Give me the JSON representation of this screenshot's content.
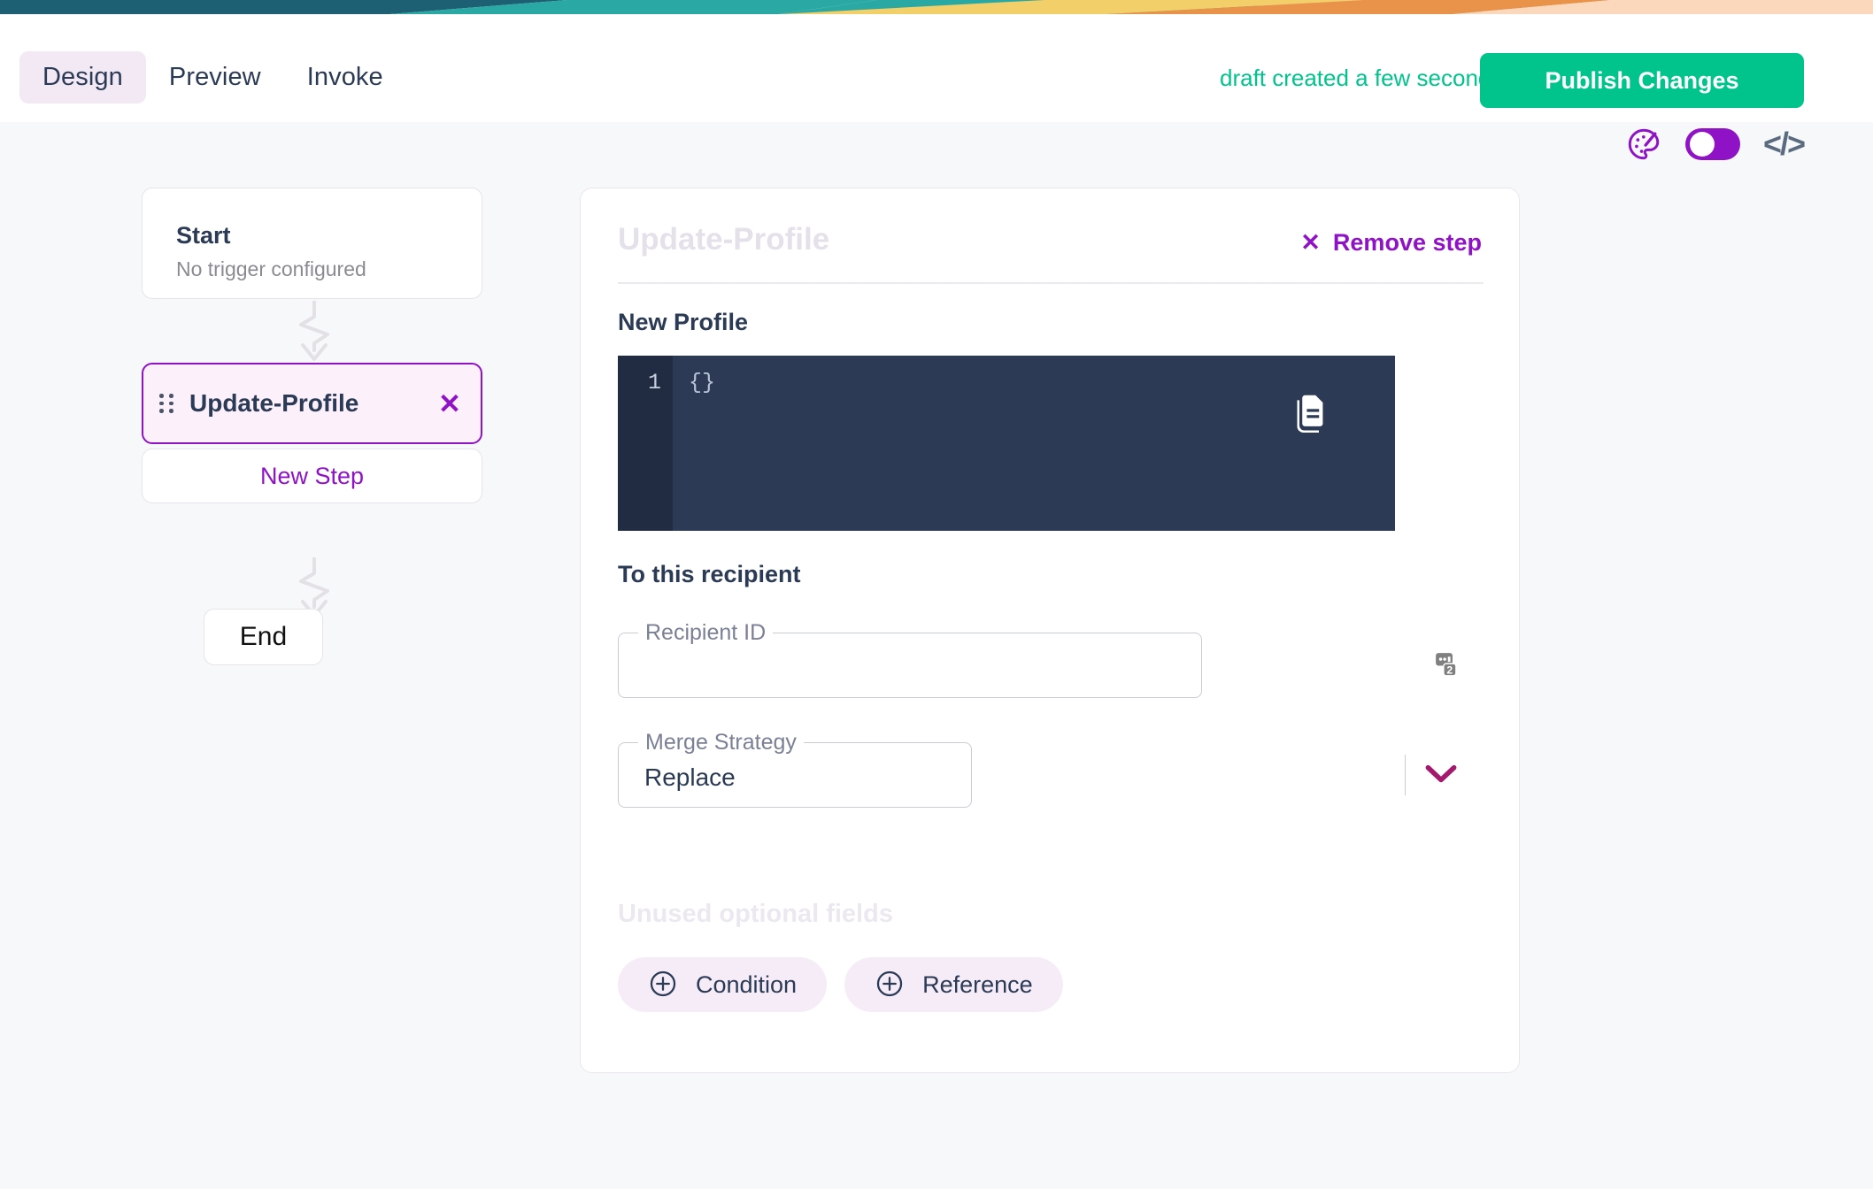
{
  "theme": {
    "accent_purple": "#9012c7",
    "accent_green": "#00c48c",
    "text_dark": "#2b3a55",
    "page_bg": "#f7f8fa",
    "editor_bg": "#2c3a55",
    "stripe_colors": [
      "#1e6073",
      "#2aa9a4",
      "#f3cf6a",
      "#e8924a",
      "#fbd8bb"
    ]
  },
  "header": {
    "tabs": [
      {
        "label": "Design",
        "active": true
      },
      {
        "label": "Preview",
        "active": false
      },
      {
        "label": "Invoke",
        "active": false
      }
    ],
    "draft_status": "draft created a few seconds ago",
    "publish_label": "Publish Changes"
  },
  "toolbar": {
    "palette_icon": "palette-icon",
    "toggle_on": true,
    "code_icon_label": "</>"
  },
  "flow": {
    "start": {
      "title": "Start",
      "subtitle": "No trigger configured"
    },
    "step": {
      "label": "Update-Profile",
      "close_glyph": "✕"
    },
    "new_step_label": "New Step",
    "end_label": "End"
  },
  "detail": {
    "title": "Update-Profile",
    "remove_step": {
      "glyph": "✕",
      "label": "Remove step"
    },
    "new_profile": {
      "section_label": "New Profile",
      "line_number": "1",
      "code": "{}",
      "copy_icon": "document-copy-icon"
    },
    "recipient": {
      "section_label": "To this recipient",
      "field_label": "Recipient ID",
      "value": "",
      "placeholder": "",
      "variable_icon": "variable-badge-icon",
      "variable_badge_count": "2"
    },
    "merge_strategy": {
      "field_label": "Merge Strategy",
      "value": "Replace",
      "options": [
        "Replace"
      ]
    },
    "unused_optional": {
      "label": "Unused optional fields",
      "chips": [
        {
          "label": "Condition",
          "icon": "plus-circle-icon"
        },
        {
          "label": "Reference",
          "icon": "plus-circle-icon"
        }
      ]
    }
  }
}
